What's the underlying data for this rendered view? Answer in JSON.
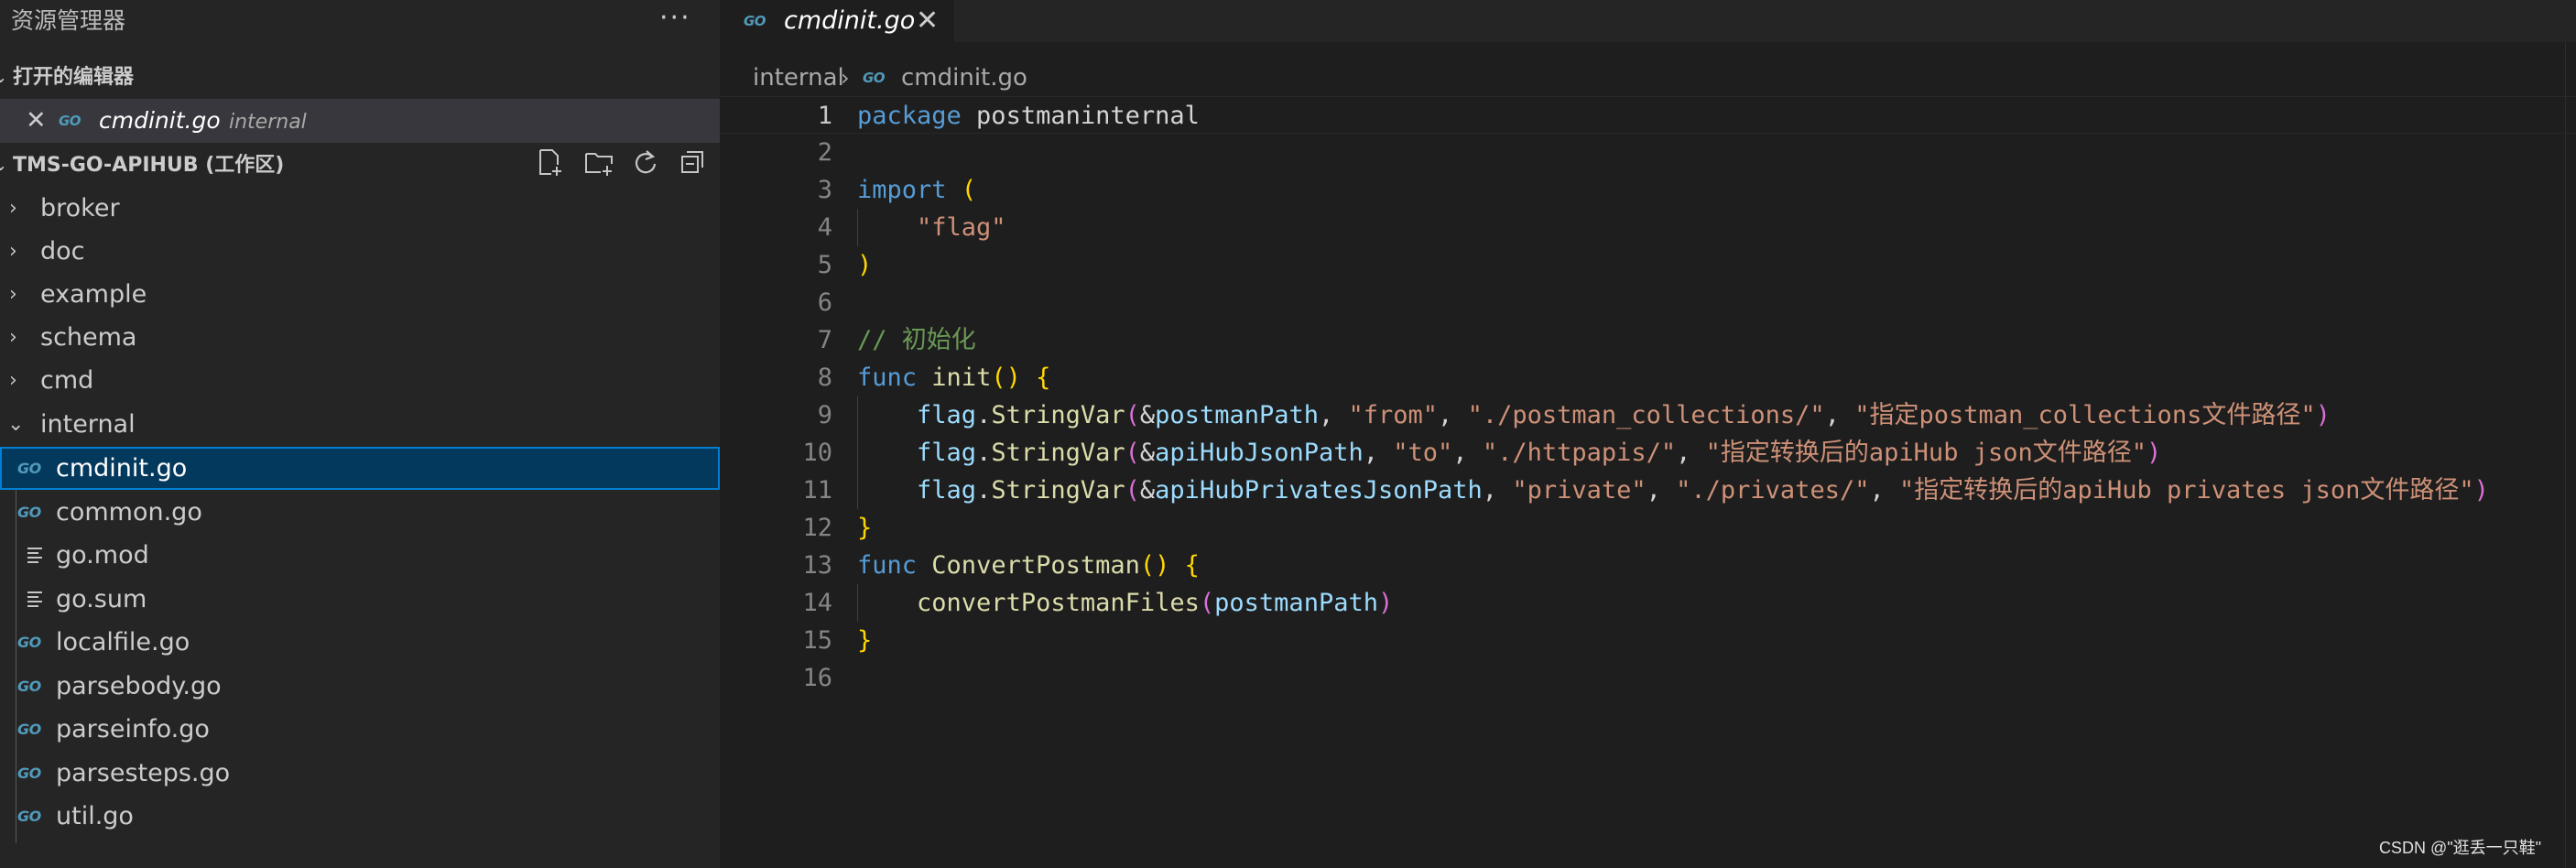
{
  "sidebar": {
    "title": "资源管理器",
    "more_icon": "ellipsis-icon",
    "open_editors": {
      "header": "打开的编辑器",
      "items": [
        {
          "name": "cmdinit.go",
          "folder": "internal",
          "icon": "go-icon"
        }
      ]
    },
    "workspace": {
      "header": "TMS-GO-APIHUB (工作区)",
      "actions": [
        "new-file-icon",
        "new-folder-icon",
        "refresh-icon",
        "collapse-all-icon"
      ],
      "tree": [
        {
          "label": "broker",
          "type": "folder",
          "expanded": false
        },
        {
          "label": "doc",
          "type": "folder",
          "expanded": false
        },
        {
          "label": "example",
          "type": "folder",
          "expanded": false
        },
        {
          "label": "schema",
          "type": "folder",
          "expanded": false
        },
        {
          "label": "cmd",
          "type": "folder",
          "expanded": false
        },
        {
          "label": "internal",
          "type": "folder",
          "expanded": true
        },
        {
          "label": "cmdinit.go",
          "type": "go",
          "selected": true
        },
        {
          "label": "common.go",
          "type": "go"
        },
        {
          "label": "go.mod",
          "type": "text"
        },
        {
          "label": "go.sum",
          "type": "text"
        },
        {
          "label": "localfile.go",
          "type": "go"
        },
        {
          "label": "parsebody.go",
          "type": "go"
        },
        {
          "label": "parseinfo.go",
          "type": "go"
        },
        {
          "label": "parsesteps.go",
          "type": "go"
        },
        {
          "label": "util.go",
          "type": "go"
        }
      ]
    }
  },
  "go_icon_text": "GO",
  "editor": {
    "tab": {
      "label": "cmdinit.go",
      "close": "✕"
    },
    "breadcrumb": {
      "folder": "internal",
      "file": "cmdinit.go"
    },
    "current_line": 1,
    "lines": [
      [
        [
          "kw",
          "package"
        ],
        [
          "pl",
          " postmaninternal"
        ]
      ],
      [],
      [
        [
          "kw",
          "import"
        ],
        [
          "pl",
          " "
        ],
        [
          "br1",
          "("
        ]
      ],
      [
        [
          "pl",
          "    "
        ],
        [
          "str",
          "\"flag\""
        ]
      ],
      [
        [
          "br1",
          ")"
        ]
      ],
      [],
      [
        [
          "cmt",
          "// 初始化"
        ]
      ],
      [
        [
          "kw",
          "func"
        ],
        [
          "pl",
          " "
        ],
        [
          "fn",
          "init"
        ],
        [
          "br1",
          "()"
        ],
        [
          "pl",
          " "
        ],
        [
          "br1",
          "{"
        ]
      ],
      [
        [
          "pl",
          "    "
        ],
        [
          "var",
          "flag"
        ],
        [
          "pl",
          "."
        ],
        [
          "fn",
          "StringVar"
        ],
        [
          "br2",
          "("
        ],
        [
          "pl",
          "&"
        ],
        [
          "var",
          "postmanPath"
        ],
        [
          "pl",
          ", "
        ],
        [
          "str",
          "\"from\""
        ],
        [
          "pl",
          ", "
        ],
        [
          "str",
          "\"./postman_collections/\""
        ],
        [
          "pl",
          ", "
        ],
        [
          "str",
          "\"指定postman_collections文件路径\""
        ],
        [
          "br2",
          ")"
        ]
      ],
      [
        [
          "pl",
          "    "
        ],
        [
          "var",
          "flag"
        ],
        [
          "pl",
          "."
        ],
        [
          "fn",
          "StringVar"
        ],
        [
          "br2",
          "("
        ],
        [
          "pl",
          "&"
        ],
        [
          "var",
          "apiHubJsonPath"
        ],
        [
          "pl",
          ", "
        ],
        [
          "str",
          "\"to\""
        ],
        [
          "pl",
          ", "
        ],
        [
          "str",
          "\"./httpapis/\""
        ],
        [
          "pl",
          ", "
        ],
        [
          "str",
          "\"指定转换后的apiHub json文件路径\""
        ],
        [
          "br2",
          ")"
        ]
      ],
      [
        [
          "pl",
          "    "
        ],
        [
          "var",
          "flag"
        ],
        [
          "pl",
          "."
        ],
        [
          "fn",
          "StringVar"
        ],
        [
          "br2",
          "("
        ],
        [
          "pl",
          "&"
        ],
        [
          "var",
          "apiHubPrivatesJsonPath"
        ],
        [
          "pl",
          ", "
        ],
        [
          "str",
          "\"private\""
        ],
        [
          "pl",
          ", "
        ],
        [
          "str",
          "\"./privates/\""
        ],
        [
          "pl",
          ", "
        ],
        [
          "str",
          "\"指定转换后的apiHub privates json文件路径\""
        ],
        [
          "br2",
          ")"
        ]
      ],
      [
        [
          "br1",
          "}"
        ]
      ],
      [
        [
          "kw",
          "func"
        ],
        [
          "pl",
          " "
        ],
        [
          "fn",
          "ConvertPostman"
        ],
        [
          "br1",
          "()"
        ],
        [
          "pl",
          " "
        ],
        [
          "br1",
          "{"
        ]
      ],
      [
        [
          "pl",
          "    "
        ],
        [
          "fn",
          "convertPostmanFiles"
        ],
        [
          "br2",
          "("
        ],
        [
          "var",
          "postmanPath"
        ],
        [
          "br2",
          ")"
        ]
      ],
      [
        [
          "br1",
          "}"
        ]
      ],
      []
    ]
  },
  "watermark": "CSDN @\"逛丢一只鞋\""
}
